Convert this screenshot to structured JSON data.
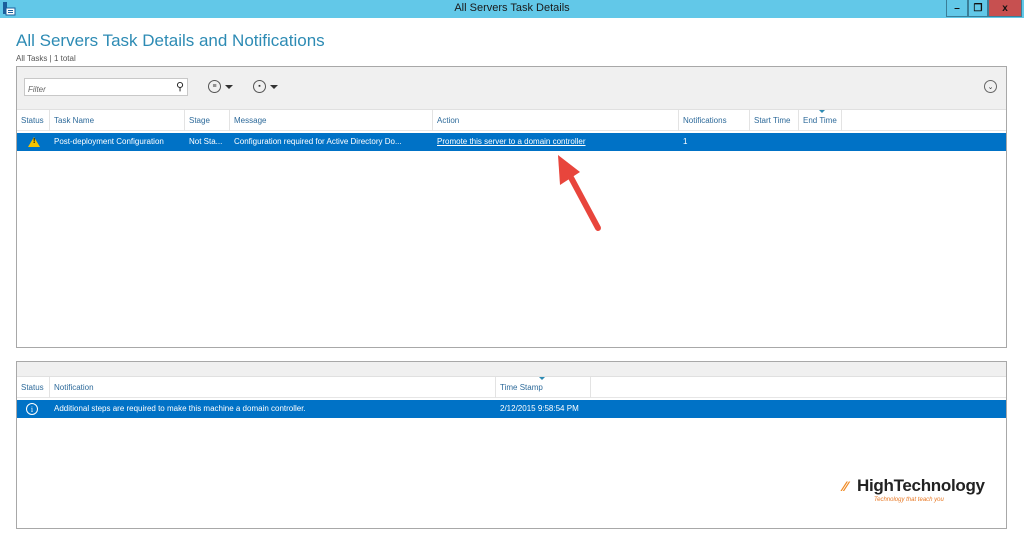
{
  "window": {
    "title": "All Servers Task Details",
    "controls": {
      "minimize": "–",
      "restore": "❐",
      "close": "x"
    }
  },
  "header": {
    "title": "All Servers Task Details and Notifications",
    "subtitle": "All Tasks | 1 total"
  },
  "tasks_panel": {
    "filter": {
      "placeholder": "Filter",
      "value": ""
    },
    "icons": {
      "search": "⚲",
      "list": "≡",
      "save": "▪",
      "expand": "⌄"
    },
    "columns": [
      "Status",
      "Task Name",
      "Stage",
      "Message",
      "Action",
      "Notifications",
      "Start Time",
      "End Time"
    ],
    "rows": [
      {
        "status_icon": "warning-icon",
        "task_name": "Post-deployment Configuration",
        "stage": "Not Sta...",
        "message": "Configuration required for Active Directory Do...",
        "action": "Promote this server to a domain controller",
        "notifications": "1",
        "start_time": "",
        "end_time": ""
      }
    ]
  },
  "notifications_panel": {
    "columns": [
      "Status",
      "Notification",
      "Time Stamp"
    ],
    "rows": [
      {
        "status_icon": "info-icon",
        "notification": "Additional steps are required to make this machine a domain controller.",
        "time_stamp": "2/12/2015 9:58:54 PM"
      }
    ]
  },
  "watermark": {
    "brand": "HighTechnology",
    "slogan": "Technology that teach you"
  },
  "colors": {
    "titlebar": "#62c8e8",
    "selection": "#0072c6",
    "title_text": "#2d8bb4",
    "arrow": "#e8453c",
    "close": "#c75050"
  }
}
